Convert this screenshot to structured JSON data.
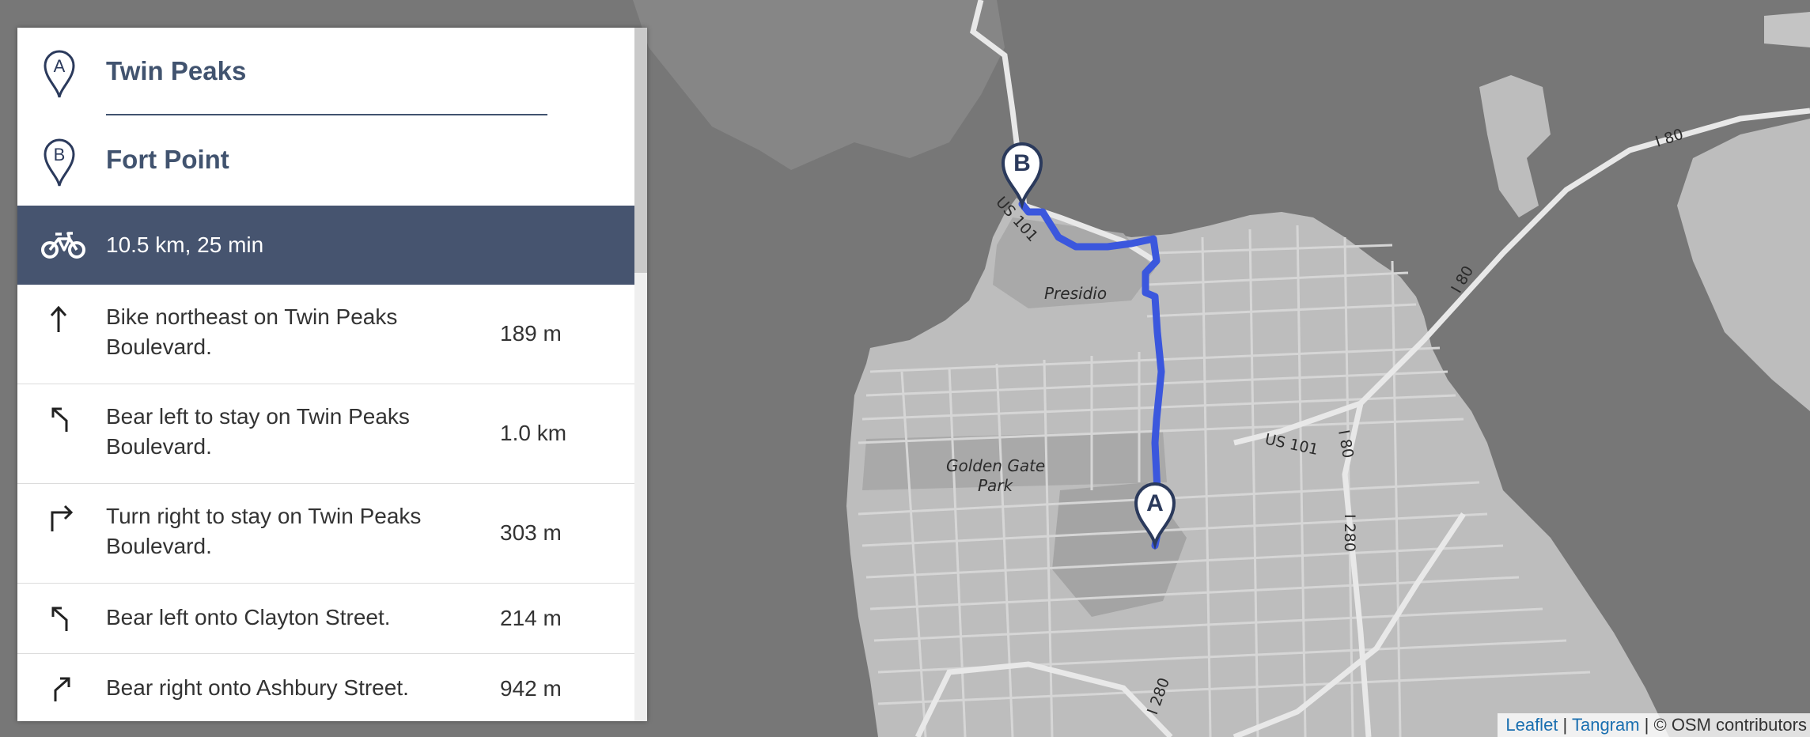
{
  "waypoints": [
    {
      "letter": "A",
      "name": "Twin Peaks"
    },
    {
      "letter": "B",
      "name": "Fort Point"
    }
  ],
  "route_summary": {
    "mode_icon": "bicycle-icon",
    "text": "10.5 km, 25 min"
  },
  "steps": [
    {
      "icon": "arrow-up-icon",
      "instruction": "Bike northeast on Twin Peaks Boulevard.",
      "distance": "189 m"
    },
    {
      "icon": "bear-left-icon",
      "instruction": "Bear left to stay on Twin Peaks Boulevard.",
      "distance": "1.0 km"
    },
    {
      "icon": "turn-right-icon",
      "instruction": "Turn right to stay on Twin Peaks Boulevard.",
      "distance": "303 m"
    },
    {
      "icon": "bear-left-icon",
      "instruction": "Bear left onto Clayton Street.",
      "distance": "214 m"
    },
    {
      "icon": "bear-right-icon",
      "instruction": "Bear right onto Ashbury Street.",
      "distance": "942 m"
    }
  ],
  "map": {
    "place_labels": {
      "presidio": "Presidio",
      "park_line1": "Golden Gate",
      "park_line2": "Park"
    },
    "road_shields": {
      "us101_a": "US 101",
      "us101_b": "US 101",
      "i80_a": "I 80",
      "i80_b": "I 80",
      "i80_c": "I 80",
      "i280_a": "I 280",
      "i280_b": "I 280"
    },
    "markers": {
      "start": "A",
      "end": "B"
    },
    "colors": {
      "route": "#3b57dd",
      "water": "#777777",
      "land": "#bdbdbd",
      "marker": "#2b3a5c"
    }
  },
  "attribution": {
    "leaflet": "Leaflet",
    "sep1": " | ",
    "tangram": "Tangram",
    "osm": " | © OSM contributors"
  }
}
